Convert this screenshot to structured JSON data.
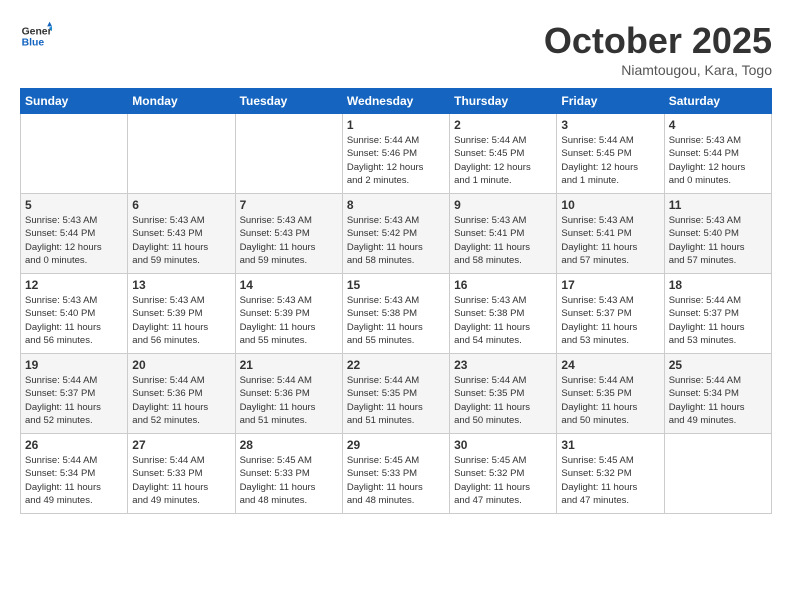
{
  "header": {
    "logo_line1": "General",
    "logo_line2": "Blue",
    "title": "October 2025",
    "subtitle": "Niamtougou, Kara, Togo"
  },
  "weekdays": [
    "Sunday",
    "Monday",
    "Tuesday",
    "Wednesday",
    "Thursday",
    "Friday",
    "Saturday"
  ],
  "weeks": [
    [
      {
        "day": "",
        "info": ""
      },
      {
        "day": "",
        "info": ""
      },
      {
        "day": "",
        "info": ""
      },
      {
        "day": "1",
        "info": "Sunrise: 5:44 AM\nSunset: 5:46 PM\nDaylight: 12 hours\nand 2 minutes."
      },
      {
        "day": "2",
        "info": "Sunrise: 5:44 AM\nSunset: 5:45 PM\nDaylight: 12 hours\nand 1 minute."
      },
      {
        "day": "3",
        "info": "Sunrise: 5:44 AM\nSunset: 5:45 PM\nDaylight: 12 hours\nand 1 minute."
      },
      {
        "day": "4",
        "info": "Sunrise: 5:43 AM\nSunset: 5:44 PM\nDaylight: 12 hours\nand 0 minutes."
      }
    ],
    [
      {
        "day": "5",
        "info": "Sunrise: 5:43 AM\nSunset: 5:44 PM\nDaylight: 12 hours\nand 0 minutes."
      },
      {
        "day": "6",
        "info": "Sunrise: 5:43 AM\nSunset: 5:43 PM\nDaylight: 11 hours\nand 59 minutes."
      },
      {
        "day": "7",
        "info": "Sunrise: 5:43 AM\nSunset: 5:43 PM\nDaylight: 11 hours\nand 59 minutes."
      },
      {
        "day": "8",
        "info": "Sunrise: 5:43 AM\nSunset: 5:42 PM\nDaylight: 11 hours\nand 58 minutes."
      },
      {
        "day": "9",
        "info": "Sunrise: 5:43 AM\nSunset: 5:41 PM\nDaylight: 11 hours\nand 58 minutes."
      },
      {
        "day": "10",
        "info": "Sunrise: 5:43 AM\nSunset: 5:41 PM\nDaylight: 11 hours\nand 57 minutes."
      },
      {
        "day": "11",
        "info": "Sunrise: 5:43 AM\nSunset: 5:40 PM\nDaylight: 11 hours\nand 57 minutes."
      }
    ],
    [
      {
        "day": "12",
        "info": "Sunrise: 5:43 AM\nSunset: 5:40 PM\nDaylight: 11 hours\nand 56 minutes."
      },
      {
        "day": "13",
        "info": "Sunrise: 5:43 AM\nSunset: 5:39 PM\nDaylight: 11 hours\nand 56 minutes."
      },
      {
        "day": "14",
        "info": "Sunrise: 5:43 AM\nSunset: 5:39 PM\nDaylight: 11 hours\nand 55 minutes."
      },
      {
        "day": "15",
        "info": "Sunrise: 5:43 AM\nSunset: 5:38 PM\nDaylight: 11 hours\nand 55 minutes."
      },
      {
        "day": "16",
        "info": "Sunrise: 5:43 AM\nSunset: 5:38 PM\nDaylight: 11 hours\nand 54 minutes."
      },
      {
        "day": "17",
        "info": "Sunrise: 5:43 AM\nSunset: 5:37 PM\nDaylight: 11 hours\nand 53 minutes."
      },
      {
        "day": "18",
        "info": "Sunrise: 5:44 AM\nSunset: 5:37 PM\nDaylight: 11 hours\nand 53 minutes."
      }
    ],
    [
      {
        "day": "19",
        "info": "Sunrise: 5:44 AM\nSunset: 5:37 PM\nDaylight: 11 hours\nand 52 minutes."
      },
      {
        "day": "20",
        "info": "Sunrise: 5:44 AM\nSunset: 5:36 PM\nDaylight: 11 hours\nand 52 minutes."
      },
      {
        "day": "21",
        "info": "Sunrise: 5:44 AM\nSunset: 5:36 PM\nDaylight: 11 hours\nand 51 minutes."
      },
      {
        "day": "22",
        "info": "Sunrise: 5:44 AM\nSunset: 5:35 PM\nDaylight: 11 hours\nand 51 minutes."
      },
      {
        "day": "23",
        "info": "Sunrise: 5:44 AM\nSunset: 5:35 PM\nDaylight: 11 hours\nand 50 minutes."
      },
      {
        "day": "24",
        "info": "Sunrise: 5:44 AM\nSunset: 5:35 PM\nDaylight: 11 hours\nand 50 minutes."
      },
      {
        "day": "25",
        "info": "Sunrise: 5:44 AM\nSunset: 5:34 PM\nDaylight: 11 hours\nand 49 minutes."
      }
    ],
    [
      {
        "day": "26",
        "info": "Sunrise: 5:44 AM\nSunset: 5:34 PM\nDaylight: 11 hours\nand 49 minutes."
      },
      {
        "day": "27",
        "info": "Sunrise: 5:44 AM\nSunset: 5:33 PM\nDaylight: 11 hours\nand 49 minutes."
      },
      {
        "day": "28",
        "info": "Sunrise: 5:45 AM\nSunset: 5:33 PM\nDaylight: 11 hours\nand 48 minutes."
      },
      {
        "day": "29",
        "info": "Sunrise: 5:45 AM\nSunset: 5:33 PM\nDaylight: 11 hours\nand 48 minutes."
      },
      {
        "day": "30",
        "info": "Sunrise: 5:45 AM\nSunset: 5:32 PM\nDaylight: 11 hours\nand 47 minutes."
      },
      {
        "day": "31",
        "info": "Sunrise: 5:45 AM\nSunset: 5:32 PM\nDaylight: 11 hours\nand 47 minutes."
      },
      {
        "day": "",
        "info": ""
      }
    ]
  ]
}
